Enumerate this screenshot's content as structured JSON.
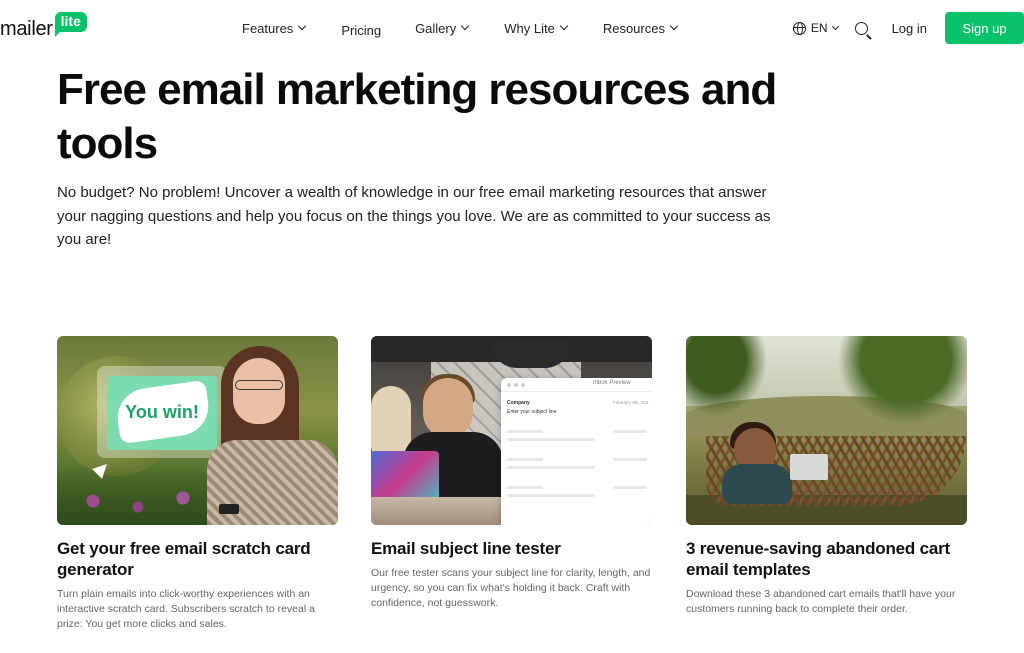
{
  "nav": {
    "logo": {
      "word": "mailer",
      "badge": "lite"
    },
    "menu": {
      "features": "Features",
      "pricing": "Pricing",
      "gallery": "Gallery",
      "why_lite": "Why Lite",
      "resources": "Resources"
    },
    "language": "EN",
    "login": "Log in",
    "signup": "Sign up"
  },
  "hero": {
    "title": "Free email marketing resources and tools",
    "text": "No budget? No problem! Uncover a wealth of knowledge in our free email marketing resources that answer your nagging questions and help you focus on the things you love. We are as committed to your success as you are!"
  },
  "cards": [
    {
      "title": "Get your free email scratch card generator",
      "description": "Turn plain emails into click-worthy experiences with an interactive scratch card. Subscribers scratch to reveal a prize: You get more clicks and sales.",
      "image_text": "You win!"
    },
    {
      "title": "Email subject line tester",
      "description": "Our free tester scans your subject line for clarity, length, and urgency, so you can fix what's holding it back. Craft with confidence, not guesswork.",
      "preview": {
        "header": "Inbox Preview",
        "company": "Company",
        "date": "February 8th, 202",
        "subject": "Enter your subject line"
      }
    },
    {
      "title": "3 revenue-saving abandoned cart email templates",
      "description": "Download these 3 abandoned cart emails that'll have your customers running back to complete their order."
    }
  ],
  "colors": {
    "brand_green": "#09c269",
    "text": "#111111",
    "muted": "#666666"
  }
}
